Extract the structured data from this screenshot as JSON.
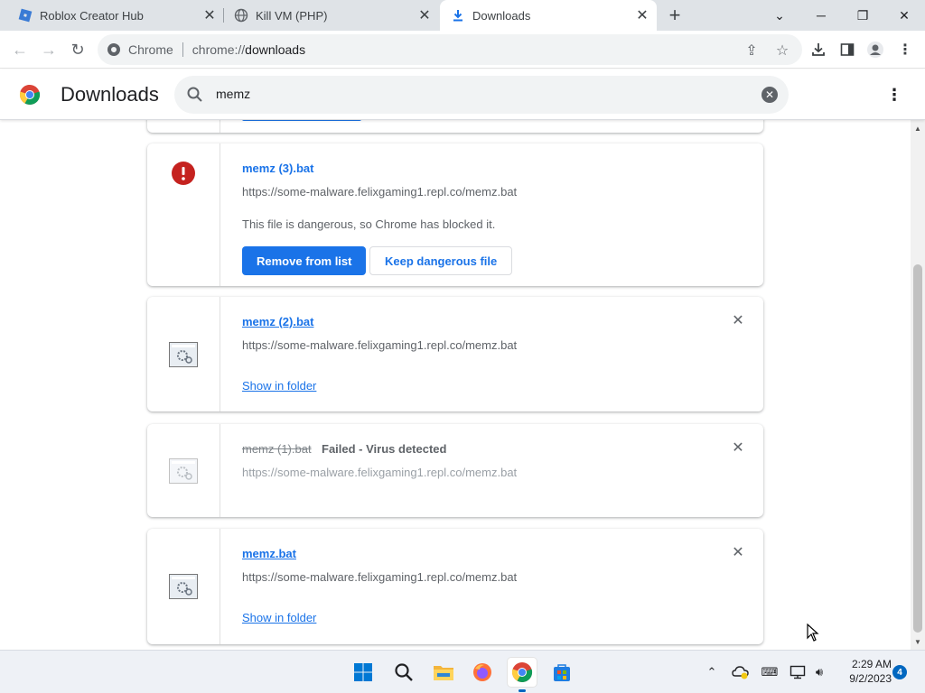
{
  "browser": {
    "tabs": [
      {
        "title": "Roblox Creator Hub",
        "icon": "roblox-icon",
        "active": false
      },
      {
        "title": "Kill VM (PHP)",
        "icon": "globe-icon",
        "active": false
      },
      {
        "title": "Downloads",
        "icon": "download-icon",
        "active": true
      }
    ],
    "site_label": "Chrome",
    "url_scheme": "chrome://",
    "url_path": "downloads"
  },
  "downloads_page": {
    "title": "Downloads",
    "search_value": "memz",
    "items": [
      {
        "file_name": "memz (3).bat",
        "url": "https://some-malware.felixgaming1.repl.co/memz.bat",
        "description": "This file is dangerous, so Chrome has blocked it.",
        "primary_action": "Remove from list",
        "secondary_action": "Keep dangerous file",
        "state": "dangerous"
      },
      {
        "file_name": "memz (2).bat",
        "url": "https://some-malware.felixgaming1.repl.co/memz.bat",
        "link_action": "Show in folder",
        "state": "complete"
      },
      {
        "file_name": "memz (1).bat",
        "status": "Failed - Virus detected",
        "url": "https://some-malware.felixgaming1.repl.co/memz.bat",
        "state": "failed"
      },
      {
        "file_name": "memz.bat",
        "url": "https://some-malware.felixgaming1.repl.co/memz.bat",
        "link_action": "Show in folder",
        "state": "complete"
      }
    ]
  },
  "taskbar": {
    "time": "2:29 AM",
    "date": "9/2/2023",
    "notification_count": "4",
    "apps": [
      "start-icon",
      "search-icon",
      "file-explorer-icon",
      "firefox-icon",
      "chrome-icon",
      "store-icon"
    ]
  },
  "colors": {
    "accent": "#1a73e8",
    "danger": "#c5221f",
    "tab_strip": "#dfe3e7"
  }
}
